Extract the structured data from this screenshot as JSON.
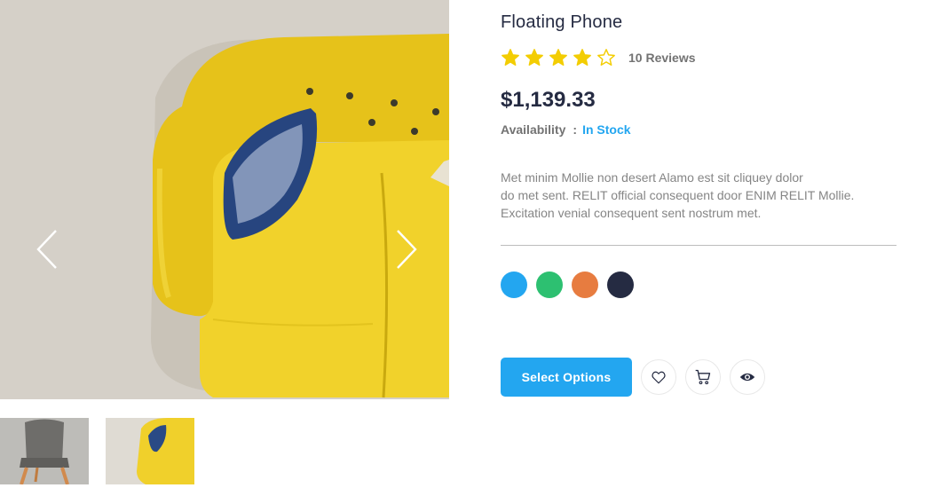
{
  "product": {
    "title": "Floating Phone",
    "rating": 4,
    "rating_max": 5,
    "reviews_label": "10 Reviews",
    "price": "$1,139.33",
    "availability_label": "Availability",
    "availability_separator": ":",
    "availability_value": "In Stock",
    "description_lines": [
      "Met minim Mollie non desert Alamo est sit cliquey dolor",
      "do met sent. RELIT official consequent door ENIM RELIT Mollie.",
      "Excitation venial consequent sent nostrum met."
    ]
  },
  "colors": {
    "swatches": [
      "#23A6F0",
      "#2DC071",
      "#E77C40",
      "#252B42"
    ],
    "star": "#F3CD03",
    "accent": "#23A6F0"
  },
  "gallery": {
    "main_image": "yellow-sofa-photo",
    "thumbnails": [
      "gray-chair-photo",
      "yellow-sofa-photo"
    ],
    "prev_icon": "chevron-left-icon",
    "next_icon": "chevron-right-icon"
  },
  "actions": {
    "select_options_label": "Select Options",
    "icons": [
      "heart-icon",
      "cart-icon",
      "eye-icon"
    ]
  }
}
